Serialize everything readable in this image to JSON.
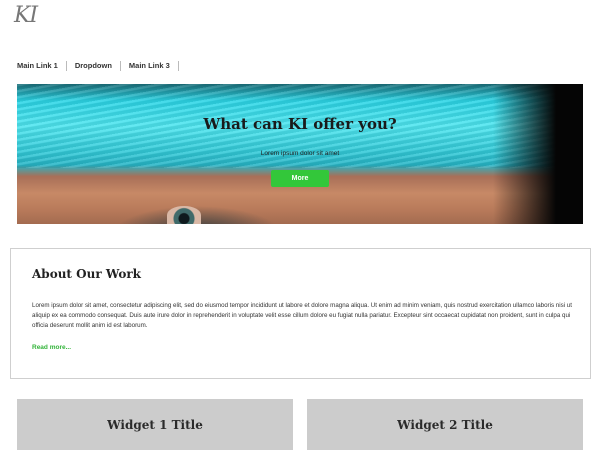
{
  "logo": {
    "text": "KI"
  },
  "nav": {
    "items": [
      {
        "label": "Main Link 1"
      },
      {
        "label": "Dropdown"
      },
      {
        "label": "Main Link 3"
      }
    ]
  },
  "hero": {
    "title": "What can KI offer you?",
    "subtitle": "Lorem ipsum dolor sit amet",
    "button_label": "More"
  },
  "about": {
    "title": "About Our Work",
    "body": "Lorem ipsum dolor sit amet, consectetur adipiscing elit, sed do eiusmod tempor incididunt ut labore et dolore magna aliqua. Ut enim ad minim veniam, quis nostrud exercitation ullamco laboris nisi ut aliquip ex ea commodo consequat. Duis aute irure dolor in reprehenderit in voluptate velit esse cillum dolore eu fugiat nulla pariatur. Excepteur sint occaecat cupidatat non proident, sunt in culpa qui officia deserunt mollit anim id est laborum.",
    "link_label": "Read more..."
  },
  "widgets": [
    {
      "title": "Widget 1 Title"
    },
    {
      "title": "Widget 2 Title"
    }
  ],
  "colors": {
    "accent_green": "#33c73a",
    "widget_bg": "#cccccc",
    "hero_turquoise": "#2bd5e6"
  }
}
